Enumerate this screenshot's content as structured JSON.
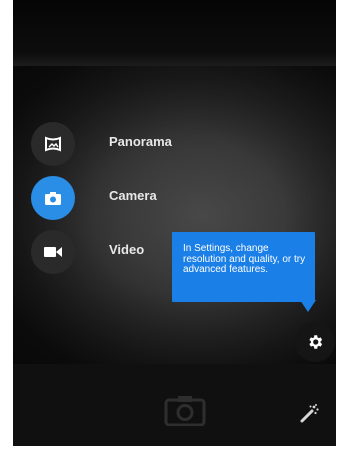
{
  "modes": [
    {
      "label": "Panorama",
      "icon": "panorama-icon",
      "active": false
    },
    {
      "label": "Camera",
      "icon": "camera-icon",
      "active": true
    },
    {
      "label": "Video",
      "icon": "video-icon",
      "active": false
    }
  ],
  "tooltip": {
    "text": "In Settings, change resolution and quality, or try advanced features."
  },
  "icons": {
    "settings": "gear-icon",
    "shutter": "camera-shutter-icon",
    "effects": "magic-wand-icon"
  },
  "colors": {
    "accent": "#2b8ee6",
    "tooltip_bg": "#1b7fe8",
    "mode_bg": "#2a2a2a"
  }
}
